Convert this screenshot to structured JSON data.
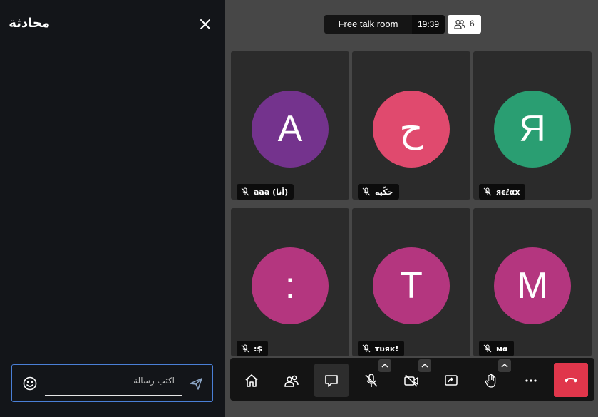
{
  "chat": {
    "title": "محادثة",
    "input_placeholder": "اكتب رسالة"
  },
  "header": {
    "room_name": "Free talk room",
    "timer": "19:39",
    "participant_count": "6"
  },
  "participants": [
    {
      "initial": "A",
      "name": "aaa (أنا)",
      "color": "#74338d",
      "muted": true
    },
    {
      "initial": "ح",
      "name": "حكّيه",
      "color": "#e04a6e",
      "muted": true
    },
    {
      "initial": "R",
      "name": "яєℓαx",
      "color": "#2a9e72",
      "muted": true
    },
    {
      "initial": ":",
      "name": ":$",
      "color": "#b4367f",
      "muted": true
    },
    {
      "initial": "T",
      "name": "тυяк!",
      "color": "#b4367f",
      "muted": true
    },
    {
      "initial": "M",
      "name": "мα",
      "color": "#b4367f",
      "muted": true
    }
  ],
  "toolbar": {
    "buttons": [
      "home-icon",
      "participants-icon",
      "chat-icon",
      "microphone-muted-icon",
      "camera-off-icon",
      "screen-share-icon",
      "raise-hand-icon",
      "more-icon",
      "hangup-icon"
    ],
    "hangup_color": "#e0364b"
  }
}
